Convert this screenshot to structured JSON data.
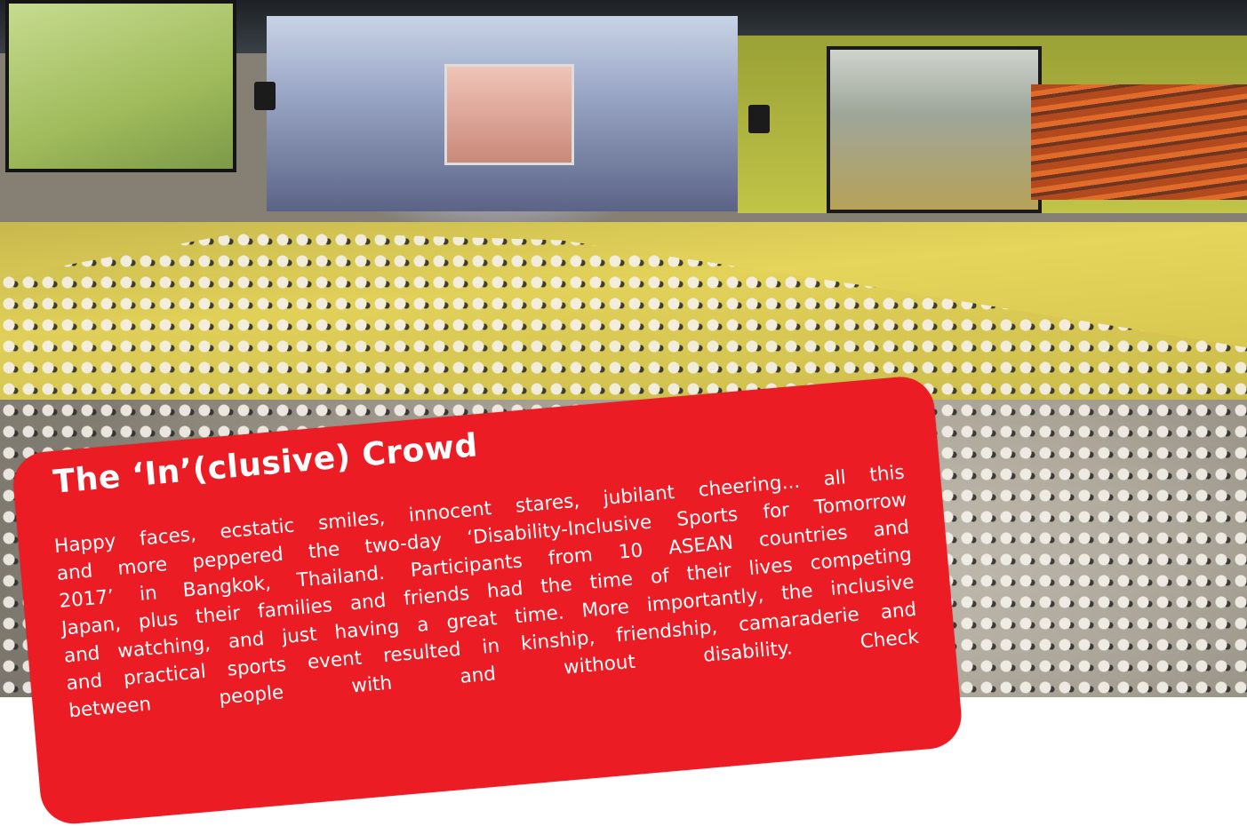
{
  "article": {
    "title": "The ‘In’(clusive) Crowd",
    "body_lines": [
      "Happy faces, ecstatic smiles, innocent stares, jubilant cheering... all this",
      "and more peppered the two-day ‘Disability-Inclusive Sports for Tomorrow",
      "2017’ in Bangkok, Thailand. Participants from 10 ASEAN countries and",
      "Japan, plus their families and friends had the time of their lives competing",
      "and watching, and just having a great time. More importantly, the inclusive",
      "and practical sports event resulted in kinship, friendship, camaraderie and",
      "between people with and without disability. Check"
    ]
  },
  "colors": {
    "card": "#ec1c24",
    "text": "#ffffff"
  },
  "photo": {
    "subject": "arena-crowd-photo"
  }
}
